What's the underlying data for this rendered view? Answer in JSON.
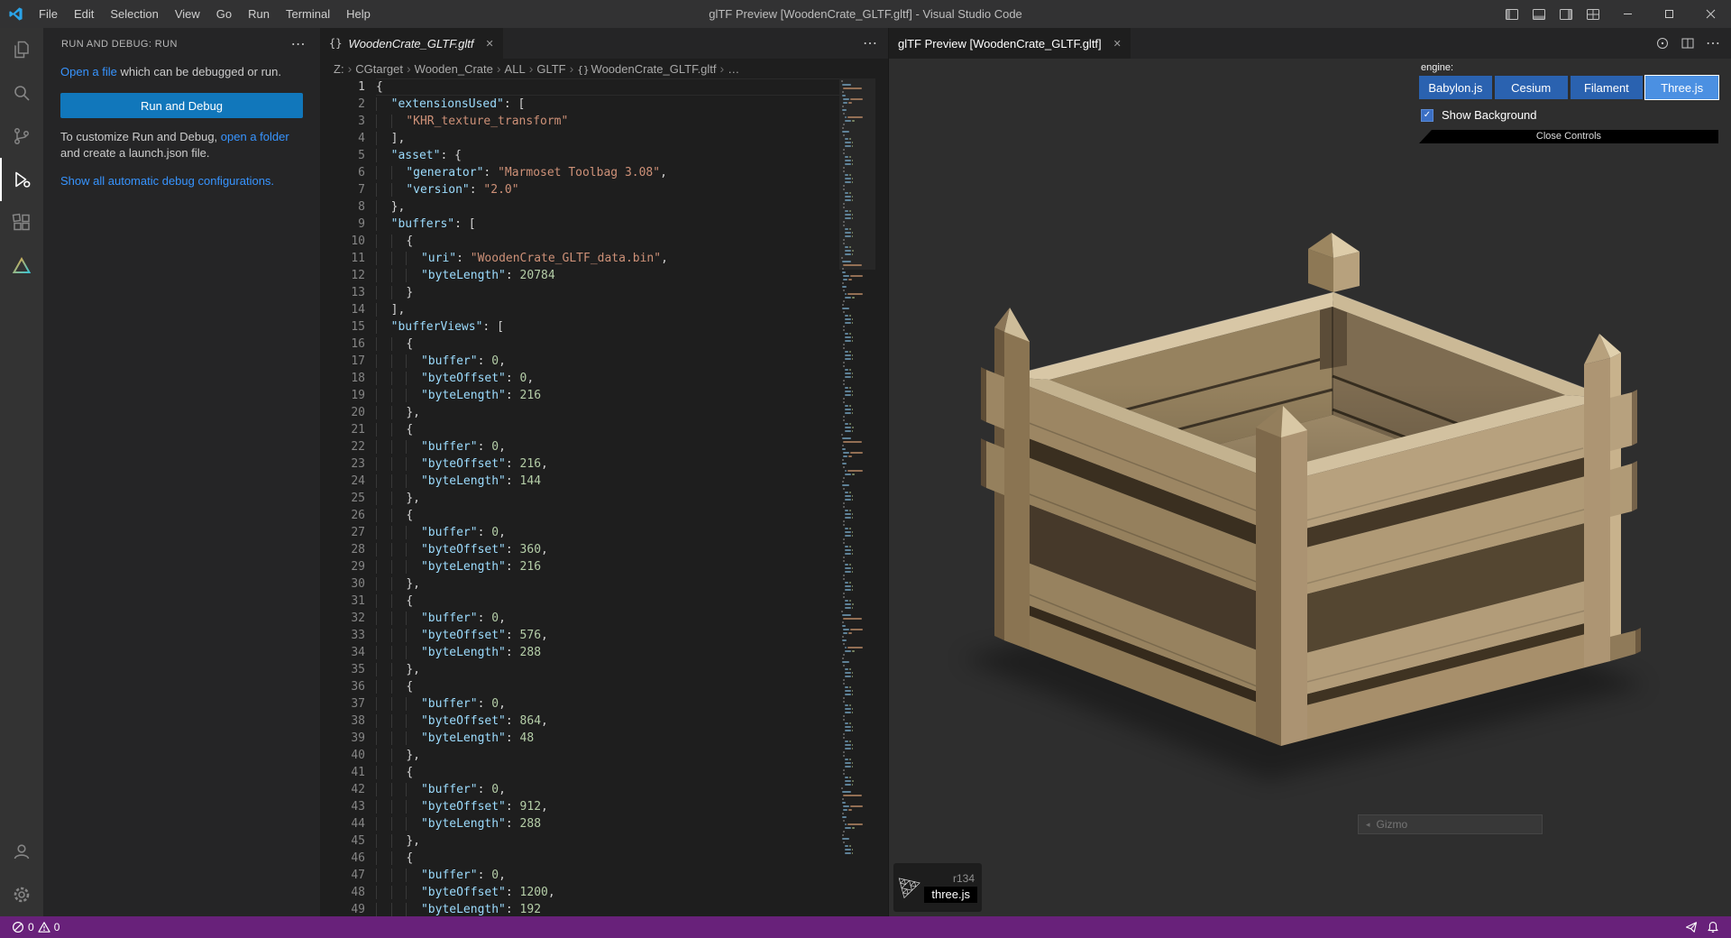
{
  "title_bar": {
    "app_title": "glTF Preview [WoodenCrate_GLTF.gltf] - Visual Studio Code",
    "menus": [
      "File",
      "Edit",
      "Selection",
      "View",
      "Go",
      "Run",
      "Terminal",
      "Help"
    ]
  },
  "activity_bar": {
    "icons": [
      "explorer",
      "search",
      "source-control",
      "run-and-debug",
      "extensions",
      "gltf-tools"
    ],
    "active": "run-and-debug",
    "bottom_icons": [
      "account",
      "settings"
    ]
  },
  "sidebar": {
    "header": "RUN AND DEBUG: RUN",
    "para1_link": "Open a file",
    "para1_rest": " which can be debugged or run.",
    "run_button": "Run and Debug",
    "para2_pre": "To customize Run and Debug, ",
    "para2_link": "open a folder",
    "para2_post": " and create a launch.json file.",
    "configs_link": "Show all automatic debug configurations."
  },
  "editor": {
    "tab_label": "WoodenCrate_GLTF.gltf",
    "tab_icon": "{}",
    "breadcrumbs": [
      "Z:",
      "CGtarget",
      "Wooden_Crate",
      "ALL",
      "GLTF",
      "WoodenCrate_GLTF.gltf",
      "…"
    ],
    "lines": [
      "{",
      "  \"extensionsUsed\": [",
      "    \"KHR_texture_transform\"",
      "  ],",
      "  \"asset\": {",
      "    \"generator\": \"Marmoset Toolbag 3.08\",",
      "    \"version\": \"2.0\"",
      "  },",
      "  \"buffers\": [",
      "    {",
      "      \"uri\": \"WoodenCrate_GLTF_data.bin\",",
      "      \"byteLength\": 20784",
      "    }",
      "  ],",
      "  \"bufferViews\": [",
      "    {",
      "      \"buffer\": 0,",
      "      \"byteOffset\": 0,",
      "      \"byteLength\": 216",
      "    },",
      "    {",
      "      \"buffer\": 0,",
      "      \"byteOffset\": 216,",
      "      \"byteLength\": 144",
      "    },",
      "    {",
      "      \"buffer\": 0,",
      "      \"byteOffset\": 360,",
      "      \"byteLength\": 216",
      "    },",
      "    {",
      "      \"buffer\": 0,",
      "      \"byteOffset\": 576,",
      "      \"byteLength\": 288",
      "    },",
      "    {",
      "      \"buffer\": 0,",
      "      \"byteOffset\": 864,",
      "      \"byteLength\": 48",
      "    },",
      "    {",
      "      \"buffer\": 0,",
      "      \"byteOffset\": 912,",
      "      \"byteLength\": 288",
      "    },",
      "    {",
      "      \"buffer\": 0,",
      "      \"byteOffset\": 1200,",
      "      \"byteLength\": 192"
    ]
  },
  "preview": {
    "tab_label": "glTF Preview [WoodenCrate_GLTF.gltf]",
    "engine_label": "engine:",
    "engines": [
      "Babylon.js",
      "Cesium",
      "Filament",
      "Three.js"
    ],
    "active_engine": "Three.js",
    "show_background_label": "Show Background",
    "close_controls_label": "Close Controls",
    "badge_version": "r134",
    "badge_name": "three.js",
    "gizmo_label": "Gizmo"
  },
  "status_bar": {
    "errors": "0",
    "warnings": "0"
  },
  "glyphs": {
    "close": "✕",
    "more": "⋯",
    "check": "✓",
    "caret": "◂"
  },
  "colors": {
    "accent_blue": "#1177bb",
    "engine_button": "#2a62b0",
    "engine_active": "#4b90e2",
    "status_purple": "#68217a",
    "link_blue": "#3794ff"
  }
}
